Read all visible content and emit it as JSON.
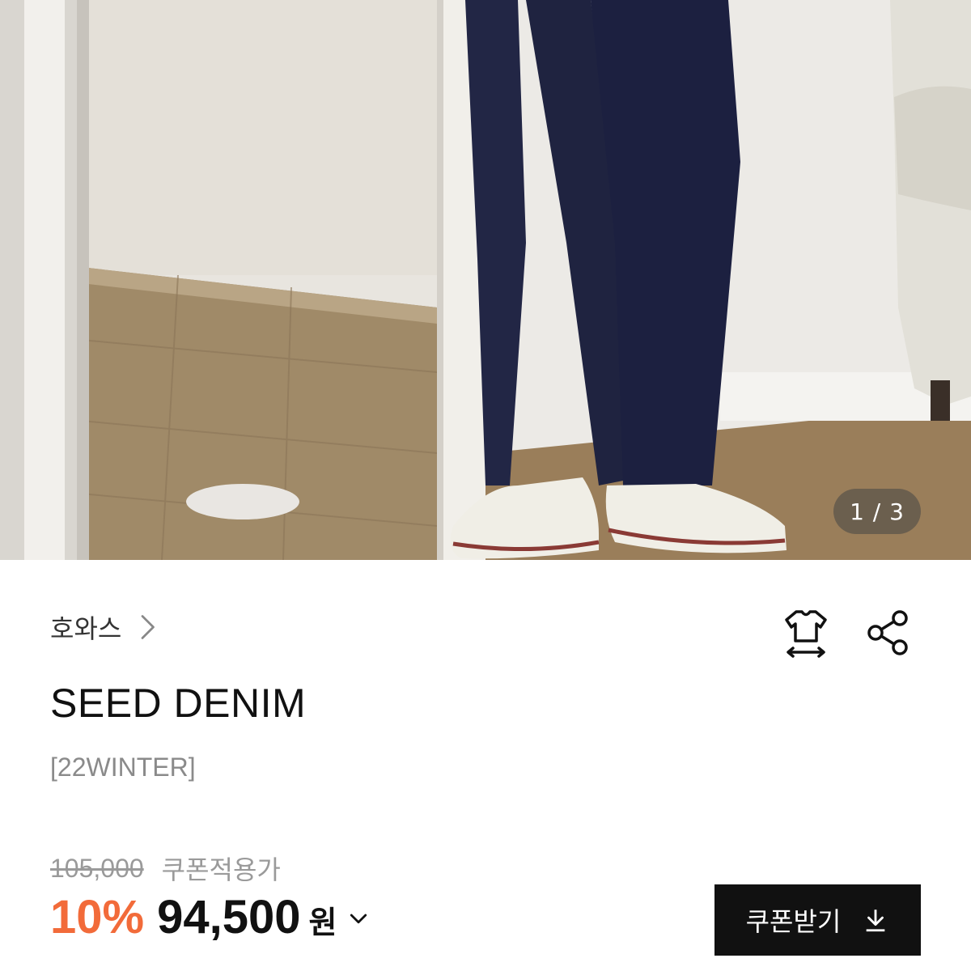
{
  "gallery": {
    "current": "1",
    "total": "3",
    "counter_text": "1 / 3"
  },
  "brand": {
    "name": "호와스"
  },
  "product": {
    "title": "SEED DENIM",
    "subtitle": "[22WINTER]"
  },
  "pricing": {
    "original_price": "105,000",
    "coupon_label": "쿠폰적용가",
    "discount_rate": "10%",
    "final_price": "94,500",
    "currency": "원"
  },
  "actions": {
    "coupon_button_label": "쿠폰받기"
  },
  "colors": {
    "accent": "#f26b3a",
    "primary": "#111111",
    "muted": "#9a9a9a"
  },
  "icons": [
    "chevron-right-icon",
    "size-guide-icon",
    "share-icon",
    "chevron-down-icon",
    "download-icon"
  ]
}
